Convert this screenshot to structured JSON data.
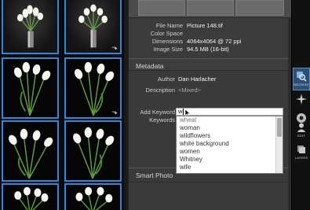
{
  "grid": {
    "thumbnails": [
      {
        "name": "thumb-1"
      },
      {
        "name": "thumb-2"
      },
      {
        "name": "thumb-3"
      },
      {
        "name": "thumb-4"
      },
      {
        "name": "thumb-5"
      },
      {
        "name": "thumb-6"
      },
      {
        "name": "thumb-7"
      },
      {
        "name": "thumb-8"
      }
    ],
    "selection_color": "#2f88d8"
  },
  "file_info": {
    "file_name_label": "File Name",
    "file_name": "Picture 148.tif",
    "color_space_label": "Color Space",
    "color_space": "",
    "dimensions_label": "Dimensions",
    "dimensions": "4064x4064 @ 72 ppi",
    "image_size_label": "Image Size",
    "image_size": "94.5 MB (16-bit)"
  },
  "metadata": {
    "header": "Metadata",
    "author_label": "Author",
    "author": "Dan Harlacher",
    "description_label": "Description",
    "description": "<Mixed>",
    "add_keyword_label": "Add Keyword",
    "add_keyword_value": "w",
    "keywords_label": "Keywords",
    "suggestions": [
      "wheat",
      "woman",
      "wildflowers",
      "white background",
      "women",
      "Whitney",
      "wife"
    ]
  },
  "smart_photo": {
    "header": "Smart Photo"
  },
  "modules": [
    {
      "label": "BROWSE",
      "icon": "browse-icon",
      "active": true
    },
    {
      "label": "",
      "icon": "effects-icon",
      "active": false
    },
    {
      "label": "",
      "icon": "fx-icon",
      "active": false
    },
    {
      "label": "EDIT",
      "icon": "portrait-icon",
      "active": false
    },
    {
      "label": "LAYERS",
      "icon": "layers-icon",
      "active": false
    }
  ],
  "colors": {
    "accent": "#2f88d8",
    "panel": "#3a3a3a",
    "active_module": "#2d4f73"
  }
}
